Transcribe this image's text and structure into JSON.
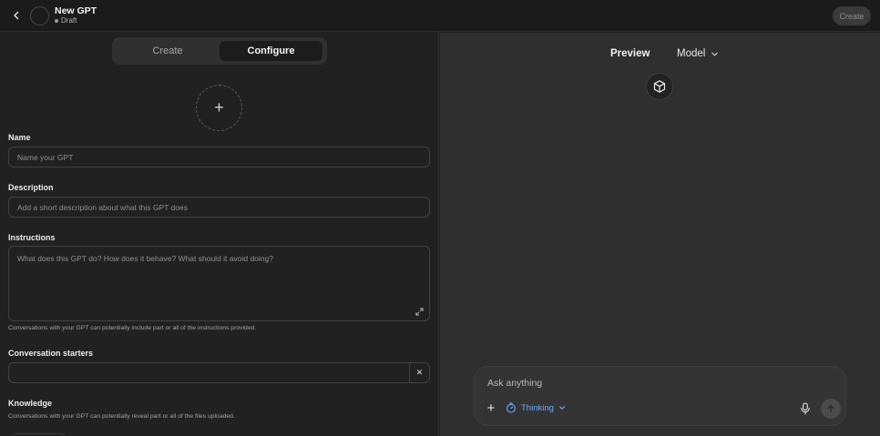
{
  "header": {
    "title": "New GPT",
    "status": "Draft",
    "create_label": "Create"
  },
  "tabs": [
    {
      "label": "Create",
      "active": false
    },
    {
      "label": "Configure",
      "active": true
    }
  ],
  "upload": {
    "icon": "plus-icon"
  },
  "form": {
    "name_label": "Name",
    "name_placeholder": "Name your GPT",
    "description_label": "Description",
    "description_placeholder": "Add a short description about what this GPT does",
    "instructions_label": "Instructions",
    "instructions_placeholder": "What does this GPT do? How does it behave? What should it avoid doing?",
    "instructions_helper": "Conversations with your GPT can potentially include part or all of the instructions provided.",
    "starters_label": "Conversation starters",
    "knowledge_label": "Knowledge",
    "knowledge_helper": "Conversations with your GPT can potentially reveal part or all of the files uploaded."
  },
  "preview": {
    "title": "Preview",
    "model_label": "Model",
    "composer_placeholder": "Ask anything",
    "thinking_label": "Thinking"
  },
  "colors": {
    "accent_link": "#6ea9ff",
    "panel_left": "#212121",
    "panel_right": "#2f2f2f"
  }
}
